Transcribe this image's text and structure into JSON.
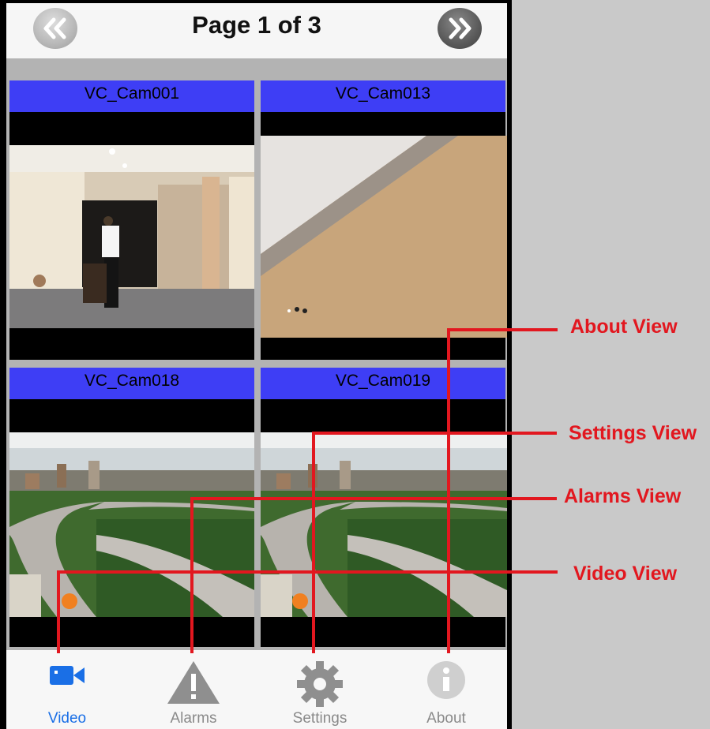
{
  "navbar": {
    "title": "Page 1 of 3",
    "prev_icon": "double-chevron-left",
    "next_icon": "double-chevron-right"
  },
  "cameras": [
    {
      "name": "VC_Cam001"
    },
    {
      "name": "VC_Cam013"
    },
    {
      "name": "VC_Cam018"
    },
    {
      "name": "VC_Cam019"
    }
  ],
  "tabs": [
    {
      "label": "Video",
      "icon": "video-camera-icon",
      "active": true
    },
    {
      "label": "Alarms",
      "icon": "warning-triangle-icon",
      "active": false
    },
    {
      "label": "Settings",
      "icon": "gear-icon",
      "active": false
    },
    {
      "label": "About",
      "icon": "info-icon",
      "active": false
    }
  ],
  "annotations": {
    "about": "About View",
    "settings": "Settings View",
    "alarms": "Alarms View",
    "video": "Video View"
  },
  "colors": {
    "label_bar": "#3e3ef5",
    "active_tab": "#1a6fe6",
    "callout": "#e2171f"
  }
}
